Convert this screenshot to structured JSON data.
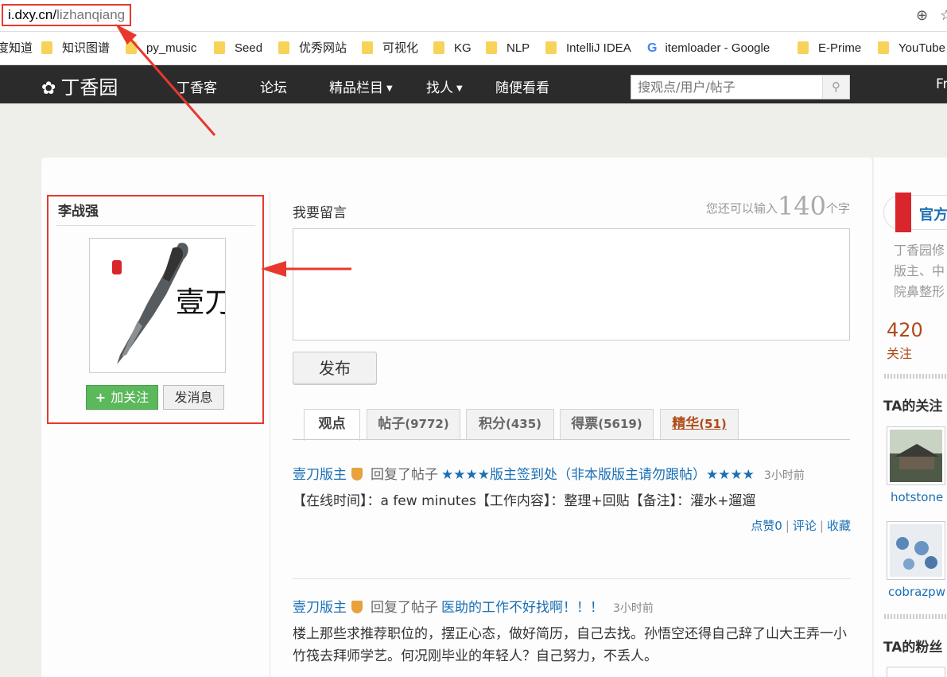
{
  "browser": {
    "url_host": "i.dxy.cn/",
    "url_path": "lizhanqiang",
    "icons": [
      "zoom-icon",
      "star-icon"
    ]
  },
  "bookmarks": [
    {
      "label": "度知道",
      "icon": "folder-icon"
    },
    {
      "label": "知识图谱",
      "icon": "folder-icon"
    },
    {
      "label": "py_music",
      "icon": "folder-icon"
    },
    {
      "label": "Seed",
      "icon": "folder-icon"
    },
    {
      "label": "优秀网站",
      "icon": "folder-icon"
    },
    {
      "label": "可视化",
      "icon": "folder-icon"
    },
    {
      "label": "KG",
      "icon": "folder-icon"
    },
    {
      "label": "NLP",
      "icon": "folder-icon"
    },
    {
      "label": "IntelliJ IDEA",
      "icon": "folder-icon"
    },
    {
      "label": "itemloader - Google",
      "icon": "google-icon"
    },
    {
      "label": "E-Prime",
      "icon": "folder-icon"
    },
    {
      "label": "YouTube",
      "icon": "folder-icon"
    }
  ],
  "site": {
    "logo": "丁香园",
    "nav": [
      "丁香客",
      "论坛",
      "精品栏目",
      "找人",
      "随便看看"
    ],
    "search_placeholder": "搜观点/用户/帖子",
    "right_cut": "Fr"
  },
  "profile": {
    "name": "李战强",
    "avatar_text": "壹刀",
    "follow_label": "加关注",
    "message_label": "发消息"
  },
  "compose": {
    "title": "我要留言",
    "counter_prefix": "您还可以输入",
    "counter_num": "140",
    "counter_suffix": "个字",
    "publish_label": "发布"
  },
  "tabs": [
    {
      "label": "观点",
      "count": ""
    },
    {
      "label": "帖子",
      "count": "(9772)"
    },
    {
      "label": "积分",
      "count": "(435)"
    },
    {
      "label": "得票",
      "count": "(5619)"
    },
    {
      "label": "精华",
      "count": "(51)"
    }
  ],
  "feed": [
    {
      "user": "壹刀版主",
      "action": "回复了帖子",
      "link": "★★★★版主签到处（非本版版主请勿跟帖）★★★★",
      "time": "3小时前",
      "body": "【在线时间】：a few minutes【工作内容】：整理+回贴【备注】：灌水+遛遛",
      "likes": "点赞0",
      "comment": "评论",
      "collect": "收藏"
    },
    {
      "user": "壹刀版主",
      "action": "回复了帖子",
      "link": "医助的工作不好找啊！！！",
      "time": "3小时前",
      "body": "楼上那些求推荐职位的，摆正心态，做好简历，自己去找。孙悟空还得自己辞了山大王弄一小竹筏去拜师学艺。何况刚毕业的年轻人？自己努力，不丢人。"
    }
  ],
  "sidebar": {
    "official_label": "官方",
    "desc_lines": [
      "丁香园修",
      "版主、中",
      "院鼻整形"
    ],
    "follow_count": "420",
    "follow_label": "关注",
    "ta_follows": "TA的关注",
    "ta_fans": "TA的粉丝",
    "follows": [
      {
        "name": "hotstone"
      },
      {
        "name": "cobrazpw"
      }
    ]
  },
  "colors": {
    "annotation_red": "#e8382e",
    "link_blue": "#1a6fb5",
    "header_dark": "#2b2b2b",
    "follow_green": "#5bb85b",
    "accent_orange": "#b04a18"
  }
}
